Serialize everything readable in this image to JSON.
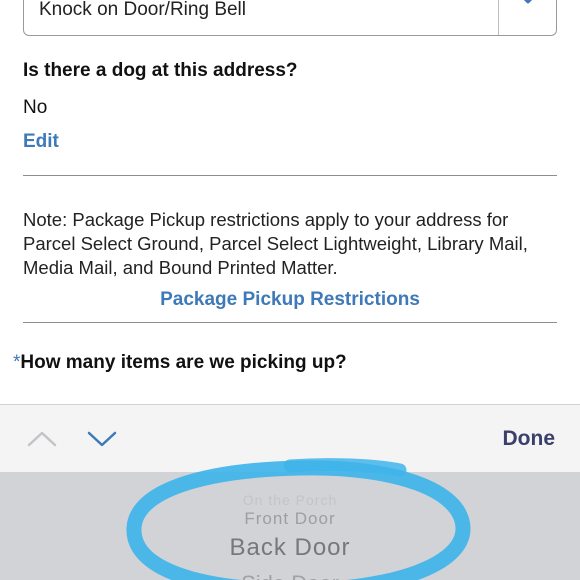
{
  "delivery_location": {
    "selected_value": "Knock on Door/Ring Bell",
    "chevron_icon": "chevron-down-icon"
  },
  "dog_question": {
    "label": "Is there a dog at this address?",
    "answer": "No",
    "edit_label": "Edit"
  },
  "note": {
    "text": "Note: Package Pickup restrictions apply to your address for Parcel Select Ground, Parcel Select Lightweight, Library Mail, Media Mail, and Bound Printed Matter.",
    "link_label": "Package Pickup Restrictions"
  },
  "items_question": {
    "required_marker": "*",
    "label": "How many items are we picking up?"
  },
  "toolbar": {
    "prev_icon": "chevron-up-icon",
    "next_icon": "chevron-down-icon",
    "done_label": "Done"
  },
  "picker": {
    "options": [
      "On the Porch",
      "Front Door",
      "Back Door",
      "Side Door"
    ],
    "selected": "Back Door"
  },
  "colors": {
    "link_blue": "#3e79b8",
    "done_navy": "#3a3f6b",
    "highlight_cyan": "#3fb4ea",
    "picker_bg": "#d1d3d7"
  }
}
